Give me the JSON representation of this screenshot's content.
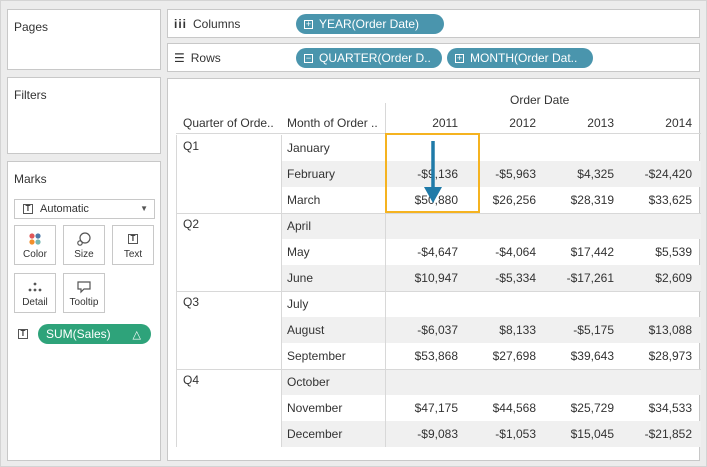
{
  "sidebar": {
    "pages_title": "Pages",
    "filters_title": "Filters",
    "marks_title": "Marks",
    "mark_type": "Automatic",
    "buttons": [
      {
        "label": "Color",
        "icon": "color-dots-icon"
      },
      {
        "label": "Size",
        "icon": "size-icon"
      },
      {
        "label": "Text",
        "icon": "text-icon"
      },
      {
        "label": "Detail",
        "icon": "detail-icon"
      },
      {
        "label": "Tooltip",
        "icon": "tooltip-icon"
      }
    ],
    "sum_pill": "SUM(Sales)",
    "sum_pill_delta": "△"
  },
  "shelves": {
    "columns_label": "Columns",
    "rows_label": "Rows",
    "columns_pills": [
      "YEAR(Order Date)"
    ],
    "rows_pills": [
      "QUARTER(Order D..",
      "MONTH(Order Dat.."
    ]
  },
  "table": {
    "header_group": "Order Date",
    "row_headers": [
      "Quarter of Orde..",
      "Month of Order .."
    ],
    "years": [
      "2011",
      "2012",
      "2013",
      "2014"
    ],
    "quarters": [
      "Q1",
      "Q2",
      "Q3",
      "Q4"
    ],
    "rows": [
      {
        "month": "January",
        "values": [
          "",
          "",
          "",
          ""
        ]
      },
      {
        "month": "February",
        "values": [
          "-$9,136",
          "-$5,963",
          "$4,325",
          "-$24,420"
        ]
      },
      {
        "month": "March",
        "values": [
          "$50,880",
          "$26,256",
          "$28,319",
          "$33,625"
        ]
      },
      {
        "month": "April",
        "values": [
          "",
          "",
          "",
          ""
        ]
      },
      {
        "month": "May",
        "values": [
          "-$4,647",
          "-$4,064",
          "$17,442",
          "$5,539"
        ]
      },
      {
        "month": "June",
        "values": [
          "$10,947",
          "-$5,334",
          "-$17,261",
          "$2,609"
        ]
      },
      {
        "month": "July",
        "values": [
          "",
          "",
          "",
          ""
        ]
      },
      {
        "month": "August",
        "values": [
          "-$6,037",
          "$8,133",
          "-$5,175",
          "$13,088"
        ]
      },
      {
        "month": "September",
        "values": [
          "$53,868",
          "$27,698",
          "$39,643",
          "$28,973"
        ]
      },
      {
        "month": "October",
        "values": [
          "",
          "",
          "",
          ""
        ]
      },
      {
        "month": "November",
        "values": [
          "$47,175",
          "$44,568",
          "$25,729",
          "$34,533"
        ]
      },
      {
        "month": "December",
        "values": [
          "-$9,083",
          "-$1,053",
          "$15,045",
          "-$21,852"
        ]
      }
    ]
  },
  "colors": {
    "pill_blue": "#4a95ad",
    "pill_green": "#2ea37a",
    "highlight_box": "#f5b320",
    "arrow": "#1f7aa8"
  }
}
